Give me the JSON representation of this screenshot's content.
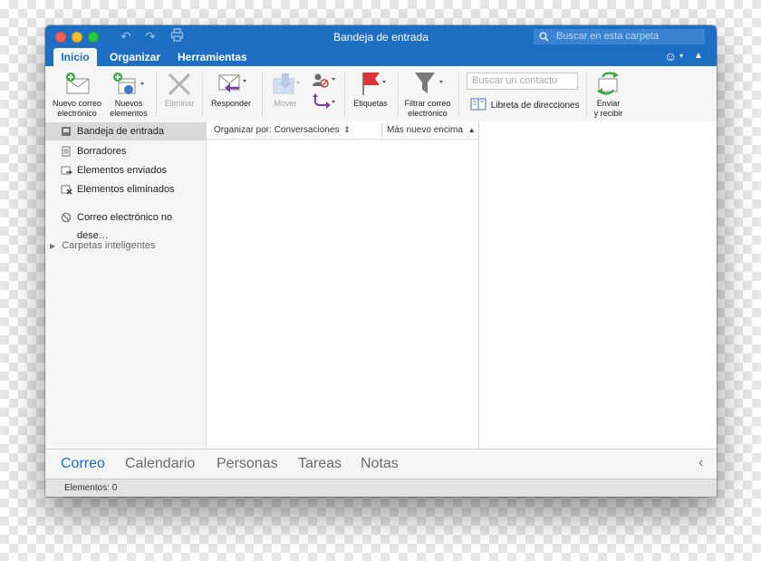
{
  "window": {
    "title": "Bandeja de entrada"
  },
  "search": {
    "placeholder": "Buscar en esta carpeta"
  },
  "tabs": [
    "Inicio",
    "Organizar",
    "Herramientas"
  ],
  "ribbon": {
    "new_email": [
      "Nuevo correo",
      "electrónico"
    ],
    "new_items": [
      "Nuevos",
      "elementos"
    ],
    "delete": "Eliminar",
    "reply": "Responder",
    "move": "Mover",
    "tags": "Etiquetas",
    "filter": [
      "Filtrar correo",
      "electrónico"
    ],
    "contact_placeholder": "Buscar un contacto",
    "address_book": "Libreta de direcciones",
    "send_receive": [
      "Enviar",
      "y recibir"
    ]
  },
  "sidebar": {
    "folders": [
      {
        "label": "Bandeja de entrada",
        "icon": "inbox-icon"
      },
      {
        "label": "Borradores",
        "icon": "drafts-icon"
      },
      {
        "label": "Elementos enviados",
        "icon": "sent-icon"
      },
      {
        "label": "Elementos eliminados",
        "icon": "trash-icon"
      },
      {
        "label": "Correo electrónico no dese…",
        "icon": "junk-icon"
      }
    ],
    "smart_folders": "Carpetas inteligentes"
  },
  "list": {
    "sort_by": "Organizar por: Conversaciones",
    "order": "Más nuevo encima"
  },
  "nav": [
    "Correo",
    "Calendario",
    "Personas",
    "Tareas",
    "Notas"
  ],
  "status": "Elementos: 0",
  "colors": {
    "accent": "#1e6fc4"
  }
}
